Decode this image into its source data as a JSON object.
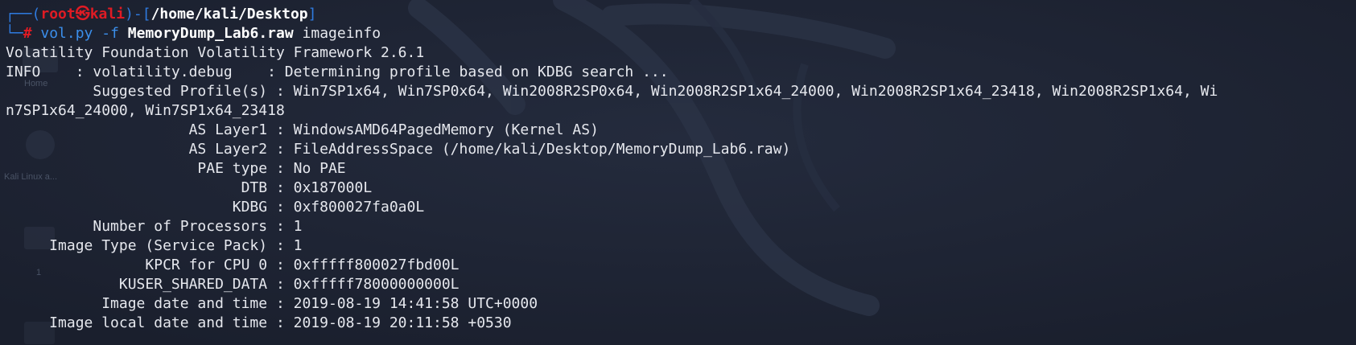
{
  "terminal": {
    "prompt": {
      "corner_top": "┌──(",
      "user": "root㉿kali",
      "mid": ")-[",
      "cwd": "/home/kali/Desktop",
      "end": "]",
      "corner_bottom": "└─",
      "hash": "# ",
      "command": "vol.py",
      "flag": "-f",
      "file": "MemoryDump_Lab6.raw",
      "plugin": "imageinfo"
    },
    "output": [
      "Volatility Foundation Volatility Framework 2.6.1",
      "INFO    : volatility.debug    : Determining profile based on KDBG search ...",
      "          Suggested Profile(s) : Win7SP1x64, Win7SP0x64, Win2008R2SP0x64, Win2008R2SP1x64_24000, Win2008R2SP1x64_23418, Win2008R2SP1x64, Wi",
      "n7SP1x64_24000, Win7SP1x64_23418",
      "                     AS Layer1 : WindowsAMD64PagedMemory (Kernel AS)",
      "                     AS Layer2 : FileAddressSpace (/home/kali/Desktop/MemoryDump_Lab6.raw)",
      "                      PAE type : No PAE",
      "                           DTB : 0x187000L",
      "                          KDBG : 0xf800027fa0a0L",
      "          Number of Processors : 1",
      "     Image Type (Service Pack) : 1",
      "                KPCR for CPU 0 : 0xfffff800027fbd00L",
      "             KUSER_SHARED_DATA : 0xfffff78000000000L",
      "           Image date and time : 2019-08-19 14:41:58 UTC+0000",
      "     Image local date and time : 2019-08-19 20:11:58 +0530"
    ]
  },
  "desktop_background": {
    "icon_labels": [
      "Home",
      "Kali Linux a...",
      "1"
    ]
  },
  "colors": {
    "background": "#1d2333",
    "text": "#e6e8ee",
    "prompt_box": "#2f7be0",
    "prompt_user": "#e01b24",
    "command": "#3b8eea"
  }
}
